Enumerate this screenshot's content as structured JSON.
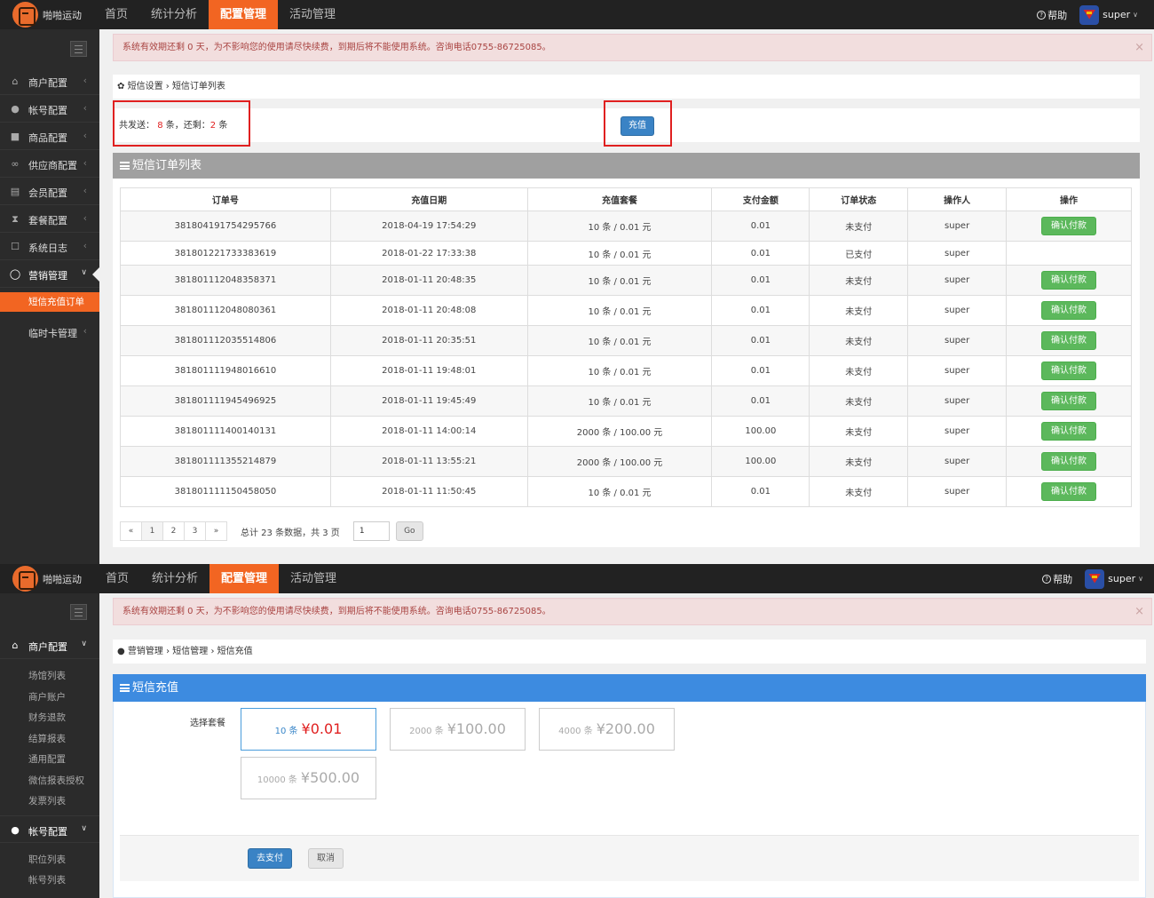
{
  "app": {
    "logo_text": "啪啪运动",
    "nav": [
      "首页",
      "统计分析",
      "配置管理",
      "活动管理"
    ],
    "active_nav": "配置管理",
    "help_label": "帮助",
    "user_name": "super",
    "accent_color": "#f26522"
  },
  "alert": {
    "message": "系统有效期还剩 0 天，为不影响您的使用请尽快续费，到期后将不能使用系统。咨询电话0755-86725085。",
    "close": "×"
  },
  "screen1": {
    "sidebar": [
      {
        "label": "商户配置",
        "icon": "home-icon"
      },
      {
        "label": "帐号配置",
        "icon": "user-icon"
      },
      {
        "label": "商品配置",
        "icon": "gift-icon"
      },
      {
        "label": "供应商配置",
        "icon": "link-icon"
      },
      {
        "label": "会员配置",
        "icon": "id-card-icon"
      },
      {
        "label": "套餐配置",
        "icon": "hourglass-icon"
      },
      {
        "label": "系统日志",
        "icon": "log-icon"
      },
      {
        "label": "营销管理",
        "icon": "comment-icon"
      }
    ],
    "sidebar_sub_active": "短信充值订单",
    "sidebar_after": "临时卡管理",
    "breadcrumb": [
      "短信设置",
      "短信订单列表"
    ],
    "stats": {
      "sent_label": "共发送：",
      "sent": "8",
      "sent_unit": "条，还剩：",
      "remain": "2",
      "remain_unit": "条"
    },
    "recharge_button": "充值",
    "table_title": "短信订单列表",
    "columns": [
      "订单号",
      "充值日期",
      "充值套餐",
      "支付金额",
      "订单状态",
      "操作人",
      "操作"
    ],
    "rows": [
      [
        "381804191754295766",
        "2018-04-19 17:54:29",
        "10 条 / 0.01 元",
        "0.01",
        "未支付",
        "super",
        "确认付款"
      ],
      [
        "381801221733383619",
        "2018-01-22 17:33:38",
        "10 条 / 0.01 元",
        "0.01",
        "已支付",
        "super",
        ""
      ],
      [
        "381801112048358371",
        "2018-01-11 20:48:35",
        "10 条 / 0.01 元",
        "0.01",
        "未支付",
        "super",
        "确认付款"
      ],
      [
        "381801112048080361",
        "2018-01-11 20:48:08",
        "10 条 / 0.01 元",
        "0.01",
        "未支付",
        "super",
        "确认付款"
      ],
      [
        "381801112035514806",
        "2018-01-11 20:35:51",
        "10 条 / 0.01 元",
        "0.01",
        "未支付",
        "super",
        "确认付款"
      ],
      [
        "381801111948016610",
        "2018-01-11 19:48:01",
        "10 条 / 0.01 元",
        "0.01",
        "未支付",
        "super",
        "确认付款"
      ],
      [
        "381801111945496925",
        "2018-01-11 19:45:49",
        "10 条 / 0.01 元",
        "0.01",
        "未支付",
        "super",
        "确认付款"
      ],
      [
        "381801111400140131",
        "2018-01-11 14:00:14",
        "2000 条 / 100.00 元",
        "100.00",
        "未支付",
        "super",
        "确认付款"
      ],
      [
        "381801111355214879",
        "2018-01-11 13:55:21",
        "2000 条 / 100.00 元",
        "100.00",
        "未支付",
        "super",
        "确认付款"
      ],
      [
        "381801111150458050",
        "2018-01-11 11:50:45",
        "10 条 / 0.01 元",
        "0.01",
        "未支付",
        "super",
        "确认付款"
      ]
    ],
    "pagination": {
      "prev": "«",
      "pages": [
        "1",
        "2",
        "3"
      ],
      "next": "»",
      "current": "1",
      "info": "总计 23 条数据，共 3 页",
      "input": "1",
      "go": "Go"
    }
  },
  "screen2": {
    "sidebar": [
      {
        "label": "商户配置",
        "icon": "home-icon",
        "subs": [
          "场馆列表",
          "商户账户",
          "财务退款",
          "结算报表",
          "通用配置",
          "微信报表授权",
          "发票列表"
        ]
      },
      {
        "label": "帐号配置",
        "icon": "user-icon",
        "subs": [
          "职位列表",
          "帐号列表"
        ]
      }
    ],
    "breadcrumb": [
      "营销管理",
      "短信管理",
      "短信充值"
    ],
    "panel_title": "短信充值",
    "select_label": "选择套餐",
    "packages": [
      {
        "count": "10 条",
        "price": "¥0.01",
        "selected": true
      },
      {
        "count": "2000 条",
        "price": "¥100.00",
        "selected": false
      },
      {
        "count": "4000 条",
        "price": "¥200.00",
        "selected": false
      },
      {
        "count": "10000 条",
        "price": "¥500.00",
        "selected": false
      }
    ],
    "pay_button": "去支付",
    "cancel_button": "取消"
  }
}
